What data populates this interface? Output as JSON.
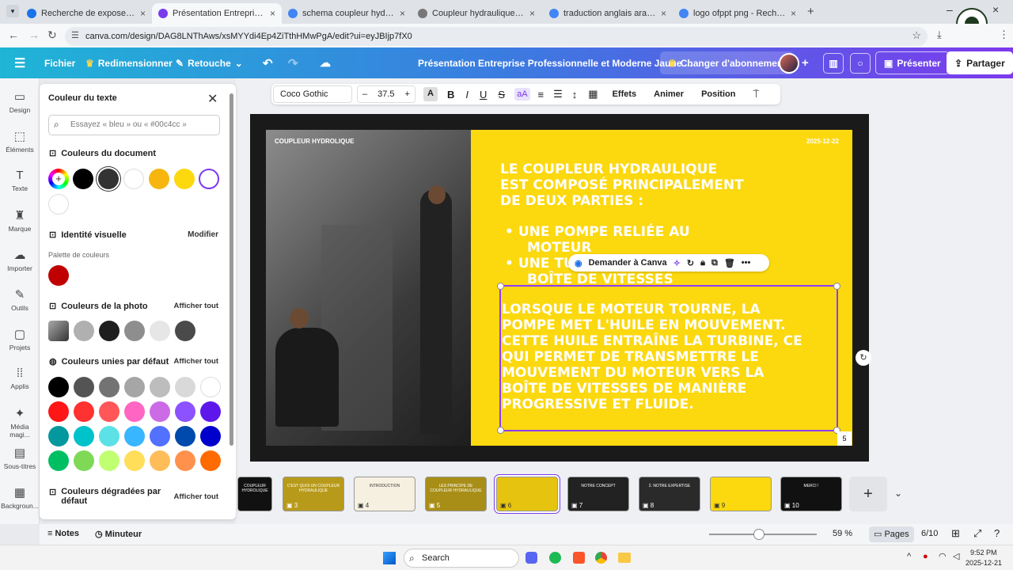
{
  "browser": {
    "tabs": [
      {
        "title": "Recherche de expose presentat",
        "color": "#1a73e8"
      },
      {
        "title": "Présentation Entreprise Profess",
        "color": "#7c3aed"
      },
      {
        "title": "schema coupleur hydraulique -",
        "color": "#4285f4"
      },
      {
        "title": "Coupleur hydraulique définitio",
        "color": "#666666"
      },
      {
        "title": "traduction anglais arabe - Rech",
        "color": "#4285f4"
      },
      {
        "title": "logo ofppt png - Recherche Go",
        "color": "#4285f4"
      }
    ],
    "url": "canva.com/design/DAG8LNThAws/xsMYYdi4Ep4ZiTthHMwPgA/edit?ui=eyJBIjp7fX0"
  },
  "header": {
    "file": "Fichier",
    "resize": "Redimensionner",
    "edit": "Retouche",
    "title": "Présentation Entreprise Professionnelle et Moderne Jaune ...",
    "upgrade": "Changer d'abonnement",
    "present": "Présenter",
    "share": "Partager"
  },
  "rail": [
    {
      "label": "Design",
      "icon": "layout-icon"
    },
    {
      "label": "Éléments",
      "icon": "shapes-icon"
    },
    {
      "label": "Texte",
      "icon": "text-icon"
    },
    {
      "label": "Marque",
      "icon": "brand-icon"
    },
    {
      "label": "Importer",
      "icon": "upload-icon"
    },
    {
      "label": "Outils",
      "icon": "tools-icon"
    },
    {
      "label": "Projets",
      "icon": "folder-icon"
    },
    {
      "label": "Applis",
      "icon": "apps-icon"
    },
    {
      "label": "Média magi...",
      "icon": "magic-media-icon"
    },
    {
      "label": "Sous-titres",
      "icon": "captions-icon"
    },
    {
      "label": "Backgroun...",
      "icon": "background-icon"
    }
  ],
  "panel": {
    "title": "Couleur du texte",
    "search_placeholder": "Essayez « bleu » ou « #00c4cc »",
    "doc_colors": "Couleurs du document",
    "brand": "Identité visuelle",
    "modify": "Modifier",
    "palette": "Palette de couleurs",
    "photo_colors": "Couleurs de la photo",
    "show_all": "Afficher tout",
    "default_colors": "Couleurs unies par défaut",
    "gradient_colors": "Couleurs dégradées par défaut",
    "doc_swatches": [
      "#000000",
      "#333333",
      "#ffffff",
      "#f6b60f",
      "#fcd80e",
      "#ffffff"
    ],
    "brand_swatches": [
      "#c00000"
    ],
    "photo_swatches": [
      "#b0b0b0",
      "#1e1e1e",
      "#8e8e8e",
      "#e6e6e6",
      "#4a4a4a"
    ],
    "default_swatches": [
      [
        "#000000",
        "#545454",
        "#737373",
        "#a6a6a6",
        "#bdbdbd",
        "#d9d9d9",
        "#ffffff"
      ],
      [
        "#ff1616",
        "#ff3131",
        "#ff5757",
        "#ff66c4",
        "#cb6ce6",
        "#8c52ff",
        "#5e17eb"
      ],
      [
        "#03989e",
        "#00c2cb",
        "#5ce1e6",
        "#38b6ff",
        "#5271ff",
        "#004aad",
        "#0000cc"
      ],
      [
        "#00bf63",
        "#7ed957",
        "#c1ff72",
        "#ffde59",
        "#ffbd59",
        "#ff914d",
        "#ff6b00"
      ]
    ]
  },
  "toolbar": {
    "font": "Coco Gothic",
    "size": "37.5",
    "effects": "Effets",
    "animate": "Animer",
    "position": "Position"
  },
  "slide": {
    "header_left": "COUPLEUR HYDROLIQUE",
    "header_right": "2025-12-22",
    "heading": [
      "LE COUPLEUR HYDRAULIQUE",
      "EST COMPOSÉ PRINCIPALEMENT",
      "DE DEUX PARTIES :"
    ],
    "bullets": [
      "UNE POMPE RELIÉE AU",
      "MOTEUR",
      "UNE TURBINE RELIÉE À LA",
      "BOÎTE DE VITESSES"
    ],
    "paragraph": [
      "LORSQUE LE MOTEUR TOURNE, LA",
      "POMPE MET L'HUILE EN MOUVEMENT.",
      "CETTE HUILE ENTRAÎNE LA TURBINE, CE",
      "QUI PERMET DE TRANSMETTRE LE",
      "MOUVEMENT DU MOTEUR VERS LA",
      "BOÎTE DE VITESSES DE MANIÈRE",
      "PROGRESSIVE ET FLUIDE."
    ],
    "page_num": "5",
    "ask_canva": "Demander à Canva"
  },
  "thumbs": [
    {
      "num": "",
      "label": "COUPLEUR HYDROLIQUE",
      "bg": "#111111"
    },
    {
      "num": "3",
      "label": "C'EST QUOI UN COUPLEUR HYDRAULIQUE",
      "bg": "#b89a1a"
    },
    {
      "num": "4",
      "label": "INTRODUCTION",
      "bg": "#f5f0e0"
    },
    {
      "num": "5",
      "label": "LES PRINCIPE DE COUPLEUR HYDRAULIQUE",
      "bg": "#a88e17"
    },
    {
      "num": "6",
      "label": "",
      "bg": "#e6c30f"
    },
    {
      "num": "7",
      "label": "NOTRE CONCEPT",
      "bg": "#222222"
    },
    {
      "num": "8",
      "label": "2. NOTRE EXPERTISE",
      "bg": "#2a2a2a"
    },
    {
      "num": "9",
      "label": "",
      "bg": "#fcd80e"
    },
    {
      "num": "10",
      "label": "MERCI !",
      "bg": "#111111"
    }
  ],
  "status": {
    "notes": "Notes",
    "timer": "Minuteur",
    "zoom": "59 %",
    "pages": "Pages",
    "page_count": "6/10"
  },
  "taskbar": {
    "search": "Search",
    "time": "9:52 PM",
    "date": "2025-12-21"
  }
}
